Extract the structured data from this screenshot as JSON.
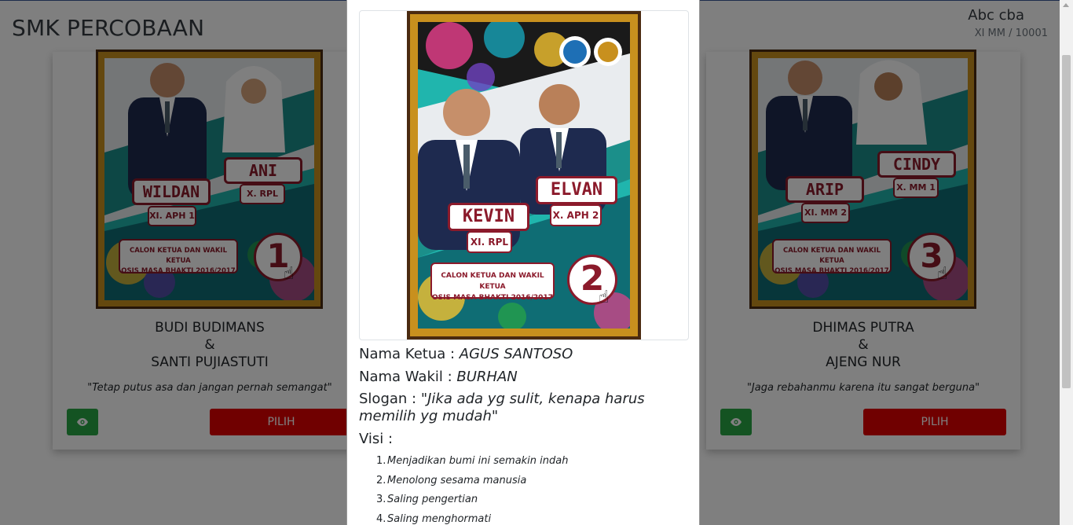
{
  "header": {
    "brand": "SMK PERCOBAAN",
    "user_name": "Abc cba",
    "user_class": "XI MM / 10001"
  },
  "cards": {
    "left": {
      "poster": {
        "ketua_badge": "WILDAN",
        "ketua_class": "XI. APH 1",
        "wakil_badge": "ANI",
        "wakil_class": "X. RPL",
        "caption_line1": "CALON KETUA DAN WAKIL KETUA",
        "caption_line2": "OSIS MASA BHAKTI 2016/2017",
        "number": "1"
      },
      "name_ketua": "BUDI BUDIMANS",
      "ampersand": "&",
      "name_wakil": "SANTI PUJIASTUTI",
      "slogan": "\"Tetap putus asa dan jangan pernah semangat\"",
      "pick_label": "PILIH",
      "view_icon": "eye-icon"
    },
    "right": {
      "poster": {
        "ketua_badge": "ARIP",
        "ketua_class": "XI. MM 2",
        "wakil_badge": "CINDY",
        "wakil_class": "X. MM 1",
        "caption_line1": "CALON KETUA DAN WAKIL KETUA",
        "caption_line2": "OSIS MASA BHAKTI 2016/2017",
        "number": "3"
      },
      "name_ketua": "DHIMAS PUTRA",
      "ampersand": "&",
      "name_wakil": "AJENG NUR",
      "slogan": "\"Jaga rebahanmu karena itu sangat berguna\"",
      "pick_label": "PILIH",
      "view_icon": "eye-icon"
    }
  },
  "modal": {
    "poster": {
      "ketua_badge": "KEVIN",
      "ketua_class": "XI. RPL",
      "wakil_badge": "ELVAN",
      "wakil_class": "X. APH 2",
      "caption_line1": "CALON KETUA DAN WAKIL KETUA",
      "caption_line2": "OSIS MASA BHAKTI 2016/2017",
      "number": "2"
    },
    "ketua_label": "Nama Ketua :",
    "ketua_value": "AGUS SANTOSO",
    "wakil_label": "Nama Wakil :",
    "wakil_value": "BURHAN",
    "slogan_label": "Slogan :",
    "slogan_value": "\"Jika ada yg sulit, kenapa harus memilih yg mudah\"",
    "visi_label": "Visi :",
    "visi_items": [
      {
        "num": "1.",
        "text": "Menjadikan bumi ini semakin indah"
      },
      {
        "num": "2.",
        "text": "Menolong sesama manusia"
      },
      {
        "num": "3.",
        "text": "Saling pengertian"
      },
      {
        "num": "4.",
        "text": "Saling menghormati"
      }
    ]
  },
  "colors": {
    "pick_button": "#e00000",
    "view_button": "#28a745",
    "poster_frame": "#c8901e",
    "badge_red": "#8b1a2b"
  }
}
